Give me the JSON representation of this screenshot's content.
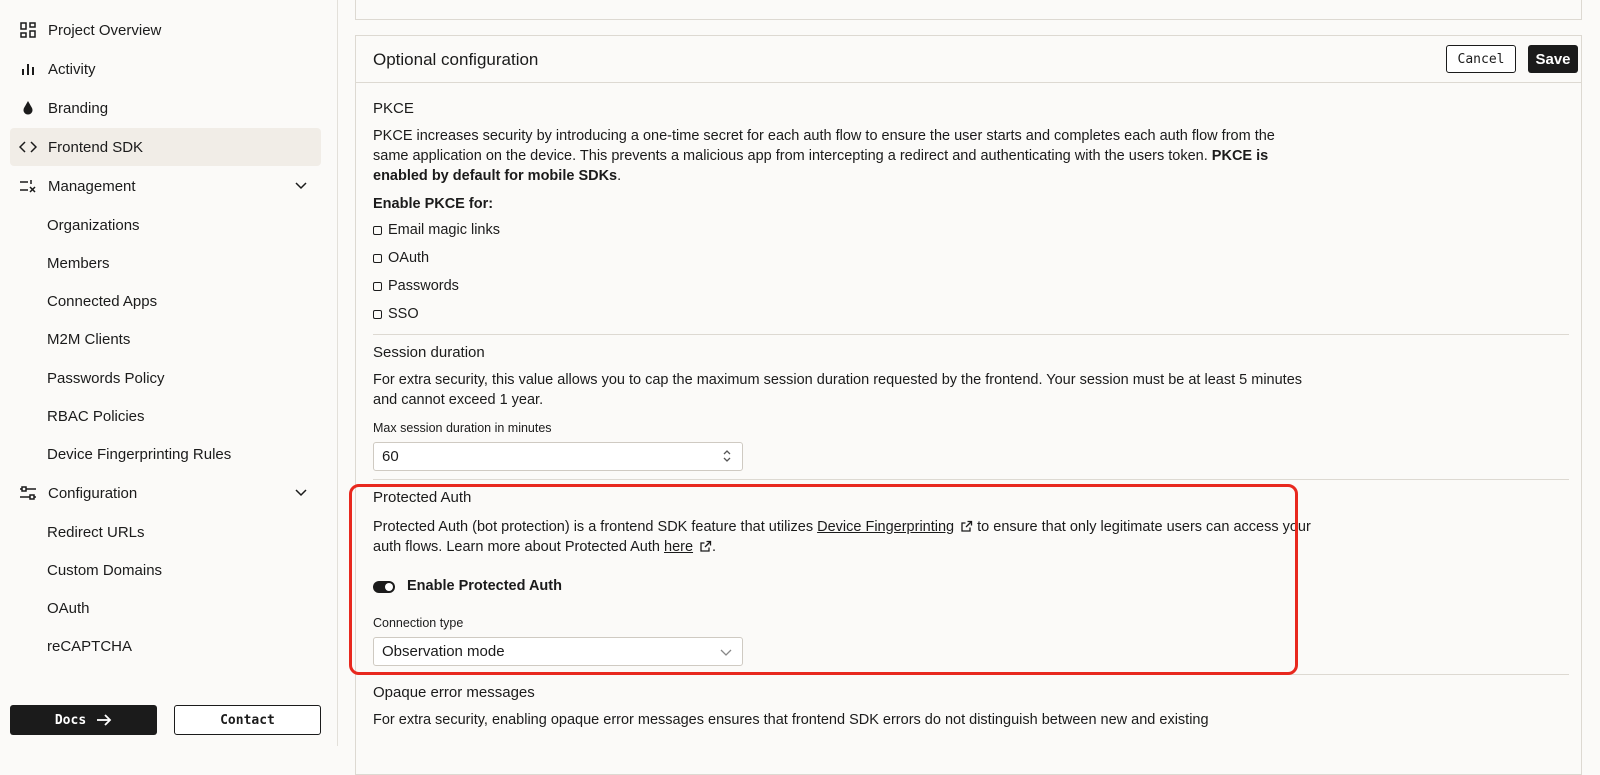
{
  "sidebar": {
    "project_overview": "Project Overview",
    "activity": "Activity",
    "branding": "Branding",
    "frontend_sdk": "Frontend SDK",
    "management": "Management",
    "management_items": [
      "Organizations",
      "Members",
      "Connected Apps",
      "M2M Clients",
      "Passwords Policy",
      "RBAC Policies",
      "Device Fingerprinting Rules"
    ],
    "configuration": "Configuration",
    "configuration_items": [
      "Redirect URLs",
      "Custom Domains",
      "OAuth",
      "reCAPTCHA"
    ],
    "docs_label": "Docs",
    "contact_label": "Contact"
  },
  "card": {
    "title": "Optional configuration",
    "cancel_label": "Cancel",
    "save_label": "Save"
  },
  "pkce": {
    "title": "PKCE",
    "description": "PKCE increases security by introducing a one-time secret for each auth flow to ensure the user starts and completes each auth flow from the same application on the device. This prevents a malicious app from intercepting a redirect and authenticating with the users token.",
    "description_bold": "PKCE is enabled by default for mobile SDKs",
    "enable_for": "Enable PKCE for:",
    "options": [
      "Email magic links",
      "OAuth",
      "Passwords",
      "SSO"
    ]
  },
  "session": {
    "title": "Session duration",
    "description": "For extra security, this value allows you to cap the maximum session duration requested by the frontend. Your session must be at least 5 minutes and cannot exceed 1 year.",
    "field_label": "Max session duration in minutes",
    "field_value": "60"
  },
  "protected_auth": {
    "title": "Protected Auth",
    "desc_part1": "Protected Auth (bot protection) is a frontend SDK feature that utilizes",
    "link1": "Device Fingerprinting",
    "desc_part2": "to ensure that only legitimate users can access your auth flows. Learn more about Protected Auth",
    "link2": "here",
    "toggle_label": "Enable Protected Auth",
    "toggle_on": true,
    "connection_label": "Connection type",
    "connection_value": "Observation mode"
  },
  "opaque": {
    "title": "Opaque error messages",
    "description": "For extra security, enabling opaque error messages ensures that frontend SDK errors do not distinguish between new and existing"
  },
  "colors": {
    "highlight": "#e8281e",
    "dark": "#1b1b1b",
    "active_bg": "#f1ede7"
  }
}
